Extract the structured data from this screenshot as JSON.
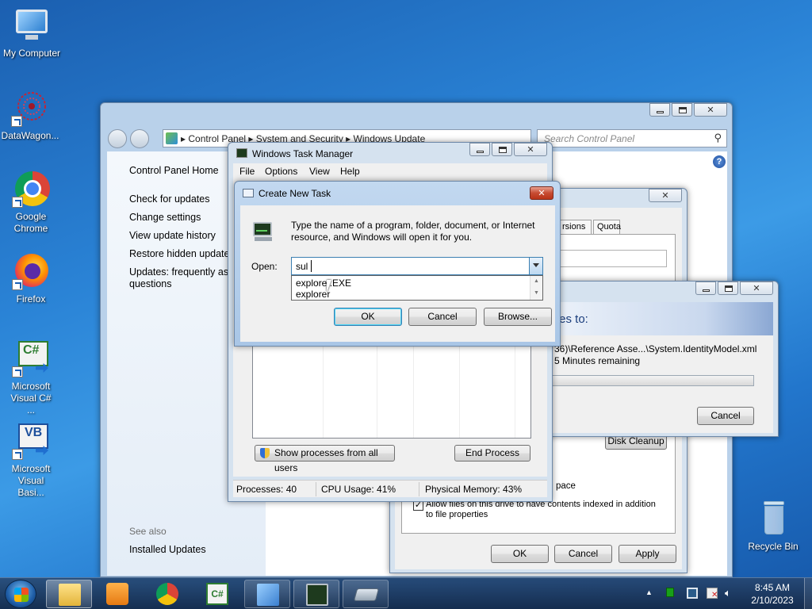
{
  "desktop": {
    "icons": [
      {
        "label": "My Computer",
        "icon": "computer-icon"
      },
      {
        "label": "DataWagon...",
        "icon": "datawagon-icon"
      },
      {
        "label": "Google Chrome",
        "icon": "chrome-icon"
      },
      {
        "label": "Firefox",
        "icon": "firefox-icon"
      },
      {
        "label": "Microsoft Visual C# ...",
        "icon": "visual-csharp-icon"
      },
      {
        "label": "Microsoft Visual Basi...",
        "icon": "visual-basic-icon"
      },
      {
        "label": "Recycle Bin",
        "icon": "recycle-bin-icon"
      }
    ]
  },
  "control_panel": {
    "breadcrumb": [
      "Control Panel",
      "System and Security",
      "Windows Update"
    ],
    "search_placeholder": "Search Control Panel",
    "sidebar": {
      "home": "Control Panel Home",
      "links": [
        "Check for updates",
        "Change settings",
        "View update history",
        "Restore hidden updates",
        "Updates: frequently aske",
        "questions"
      ],
      "see_also": "See also",
      "installed_updates": "Installed Updates"
    }
  },
  "task_manager": {
    "title": "Windows Task Manager",
    "menu": [
      "File",
      "Options",
      "View",
      "Help"
    ],
    "show_processes_label": "Show processes from all users",
    "end_process_label": "End Process",
    "status": {
      "processes": "Processes: 40",
      "cpu": "CPU Usage: 41%",
      "memory": "Physical Memory: 43%"
    }
  },
  "create_task": {
    "title": "Create New Task",
    "description": "Type the name of a program, folder, document, or Internet resource, and Windows will open it for you.",
    "open_label": "Open:",
    "input_value": "sul",
    "suggestions": [
      "explorer.EXE",
      "explorer"
    ],
    "ok_label": "OK",
    "cancel_label": "Cancel",
    "browse_label": "Browse..."
  },
  "properties": {
    "tabs": [
      "rsions",
      "Quota"
    ],
    "disk_cleanup_label": "Disk Cleanup",
    "space_fragment": "pace",
    "index_checkbox_label": "Allow files on this drive to have contents indexed in addition to file properties",
    "index_checked": true,
    "ok_label": "OK",
    "cancel_label": "Cancel",
    "apply_label": "Apply"
  },
  "copy_dialog": {
    "heading": "tes to:",
    "path": "36)\\Reference Asse...\\System.IdentityModel.xml",
    "time_remaining": "5 Minutes remaining",
    "cancel_label": "Cancel"
  },
  "taskbar": {
    "time": "8:45 AM",
    "date": "2/10/2023"
  }
}
